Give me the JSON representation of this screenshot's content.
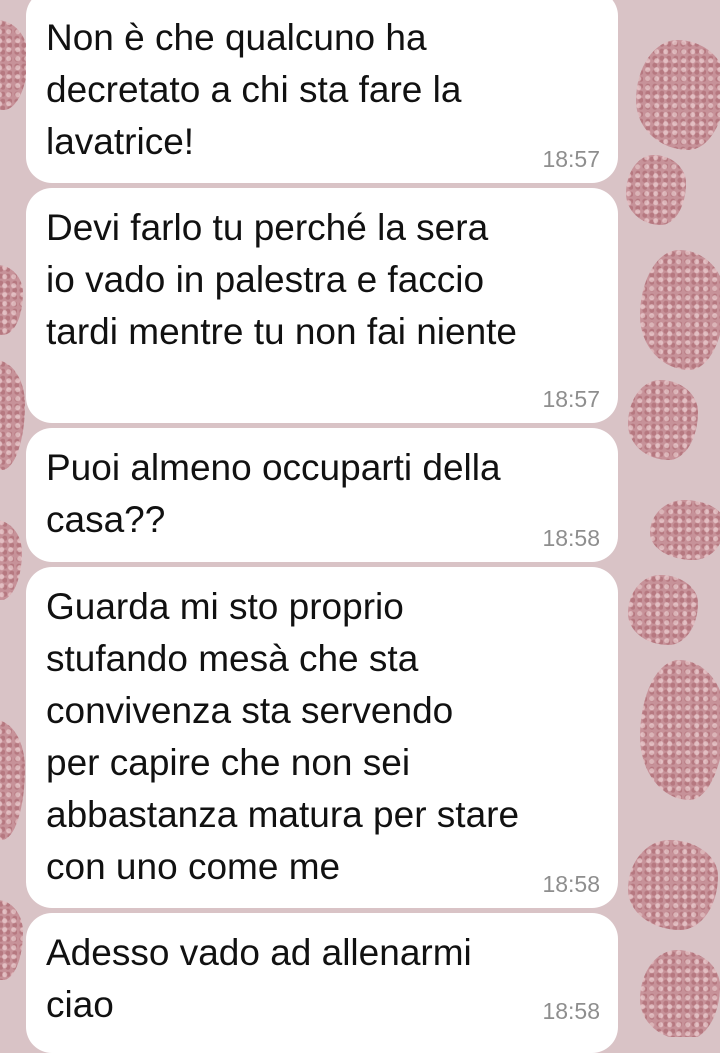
{
  "wallpaper": {
    "base_color": "#d9c3c6",
    "spot_color": "#c58a92"
  },
  "chat": {
    "messages": [
      {
        "text": "Non è che qualcuno ha\ndecretato a chi sta fare la\nlavatrice!",
        "time": "18:57"
      },
      {
        "text": "Devi farlo tu perché la sera\nio vado in palestra e faccio\ntardi mentre tu non fai niente",
        "time": "18:57"
      },
      {
        "text": "Puoi almeno occuparti della\ncasa??",
        "time": "18:58"
      },
      {
        "text": "Guarda mi sto proprio\nstufando mesà che sta\nconvivenza sta servendo\nper capire che non sei\nabbastanza matura per stare\ncon uno come me",
        "time": "18:58"
      },
      {
        "text": "Adesso vado ad allenarmi\nciao",
        "time": "18:58"
      }
    ]
  }
}
